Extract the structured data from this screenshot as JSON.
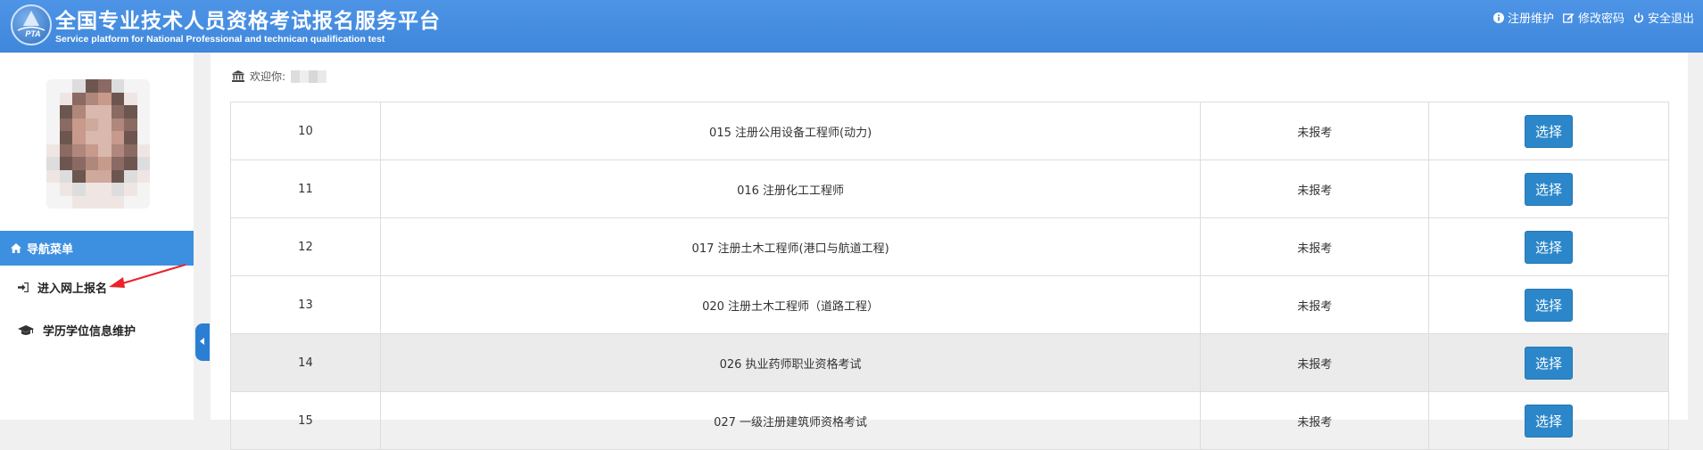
{
  "header": {
    "logo_text": "PTA",
    "title_cn": "全国专业技术人员资格考试报名服务平台",
    "title_en": "Service platform for National Professional and technican qualification test",
    "links": [
      {
        "icon": "info-icon",
        "label": "注册维护"
      },
      {
        "icon": "edit-icon",
        "label": "修改密码"
      },
      {
        "icon": "power-icon",
        "label": "安全退出"
      }
    ]
  },
  "sidebar": {
    "nav_header": "导航菜单",
    "items": [
      {
        "icon": "sign-in-icon",
        "label": "进入网上报名"
      },
      {
        "icon": "graduation-cap-icon",
        "label": "学历学位信息维护"
      }
    ]
  },
  "main": {
    "welcome_label": "欢迎你:",
    "rows": [
      {
        "no": "10",
        "name": "015 注册公用设备工程师(动力)",
        "status": "未报考",
        "action": "选择"
      },
      {
        "no": "11",
        "name": "016 注册化工工程师",
        "status": "未报考",
        "action": "选择"
      },
      {
        "no": "12",
        "name": "017 注册土木工程师(港口与航道工程)",
        "status": "未报考",
        "action": "选择"
      },
      {
        "no": "13",
        "name": "020 注册土木工程师（道路工程）",
        "status": "未报考",
        "action": "选择"
      },
      {
        "no": "14",
        "name": "026 执业药师职业资格考试",
        "status": "未报考",
        "action": "选择"
      },
      {
        "no": "15",
        "name": "027 一级注册建筑师资格考试",
        "status": "未报考",
        "action": "选择"
      }
    ]
  },
  "colors": {
    "header": "#4a90e2",
    "nav_header": "#3d8fe0",
    "button": "#2b87c9",
    "highlight_row": "#ebebeb",
    "annotation_arrow": "#e8232b"
  }
}
